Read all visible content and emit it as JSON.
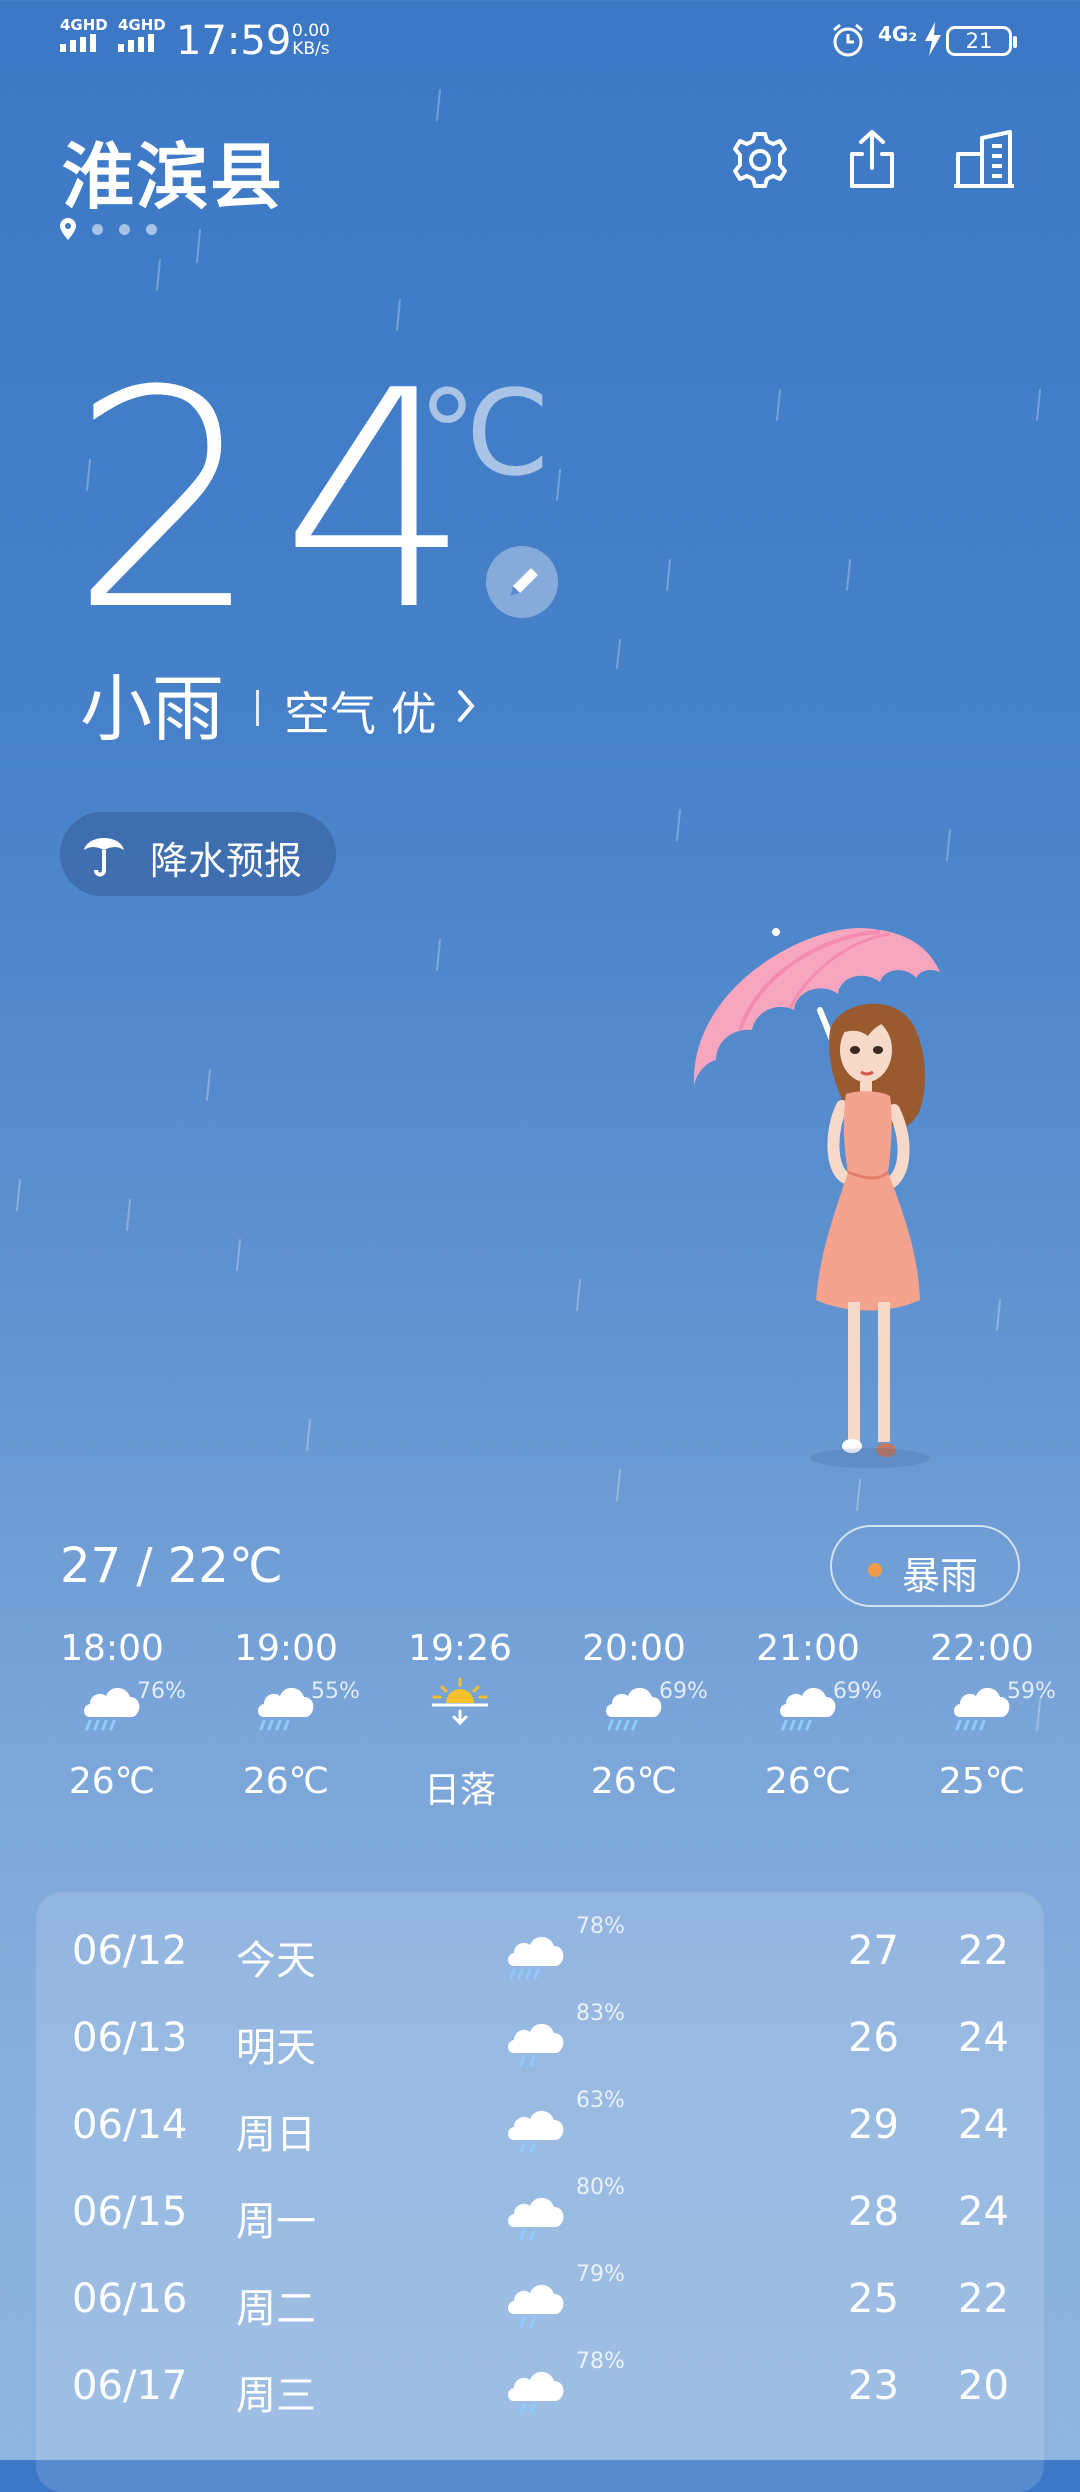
{
  "status_bar": {
    "signal_1": "4GHD",
    "signal_2": "4GHD",
    "time": "17:59",
    "net_speed_value": "0.00",
    "net_speed_unit": "KB/s",
    "network": "4G₂",
    "battery": "21"
  },
  "header": {
    "city": "淮滨县"
  },
  "current": {
    "temperature": "24",
    "unit": "℃",
    "condition": "小雨",
    "air_quality": "空气 优"
  },
  "precip_button": {
    "label": "降水预报"
  },
  "today": {
    "range": "27 / 22℃",
    "alert": "暴雨",
    "alert_color": "#f39b46"
  },
  "hourly": [
    {
      "time": "18:00",
      "icon": "rain-cloud-icon",
      "prob": "76%",
      "value": "26℃"
    },
    {
      "time": "19:00",
      "icon": "rain-cloud-icon",
      "prob": "55%",
      "value": "26℃"
    },
    {
      "time": "19:26",
      "icon": "sunset-icon",
      "prob": "",
      "value": "日落"
    },
    {
      "time": "20:00",
      "icon": "rain-cloud-icon",
      "prob": "69%",
      "value": "26℃"
    },
    {
      "time": "21:00",
      "icon": "rain-cloud-icon",
      "prob": "69%",
      "value": "26℃"
    },
    {
      "time": "22:00",
      "icon": "rain-cloud-icon",
      "prob": "59%",
      "value": "25℃"
    }
  ],
  "daily": [
    {
      "date": "06/12",
      "day": "今天",
      "icon": "heavy-rain-icon",
      "prob": "78%",
      "high": "27",
      "low": "22"
    },
    {
      "date": "06/13",
      "day": "明天",
      "icon": "light-rain-icon",
      "prob": "83%",
      "high": "26",
      "low": "24"
    },
    {
      "date": "06/14",
      "day": "周日",
      "icon": "light-rain-icon",
      "prob": "63%",
      "high": "29",
      "low": "24"
    },
    {
      "date": "06/15",
      "day": "周一",
      "icon": "light-rain-icon",
      "prob": "80%",
      "high": "28",
      "low": "24"
    },
    {
      "date": "06/16",
      "day": "周二",
      "icon": "light-rain-icon",
      "prob": "79%",
      "high": "25",
      "low": "22"
    },
    {
      "date": "06/17",
      "day": "周三",
      "icon": "light-rain-icon",
      "prob": "78%",
      "high": "23",
      "low": "20"
    }
  ]
}
